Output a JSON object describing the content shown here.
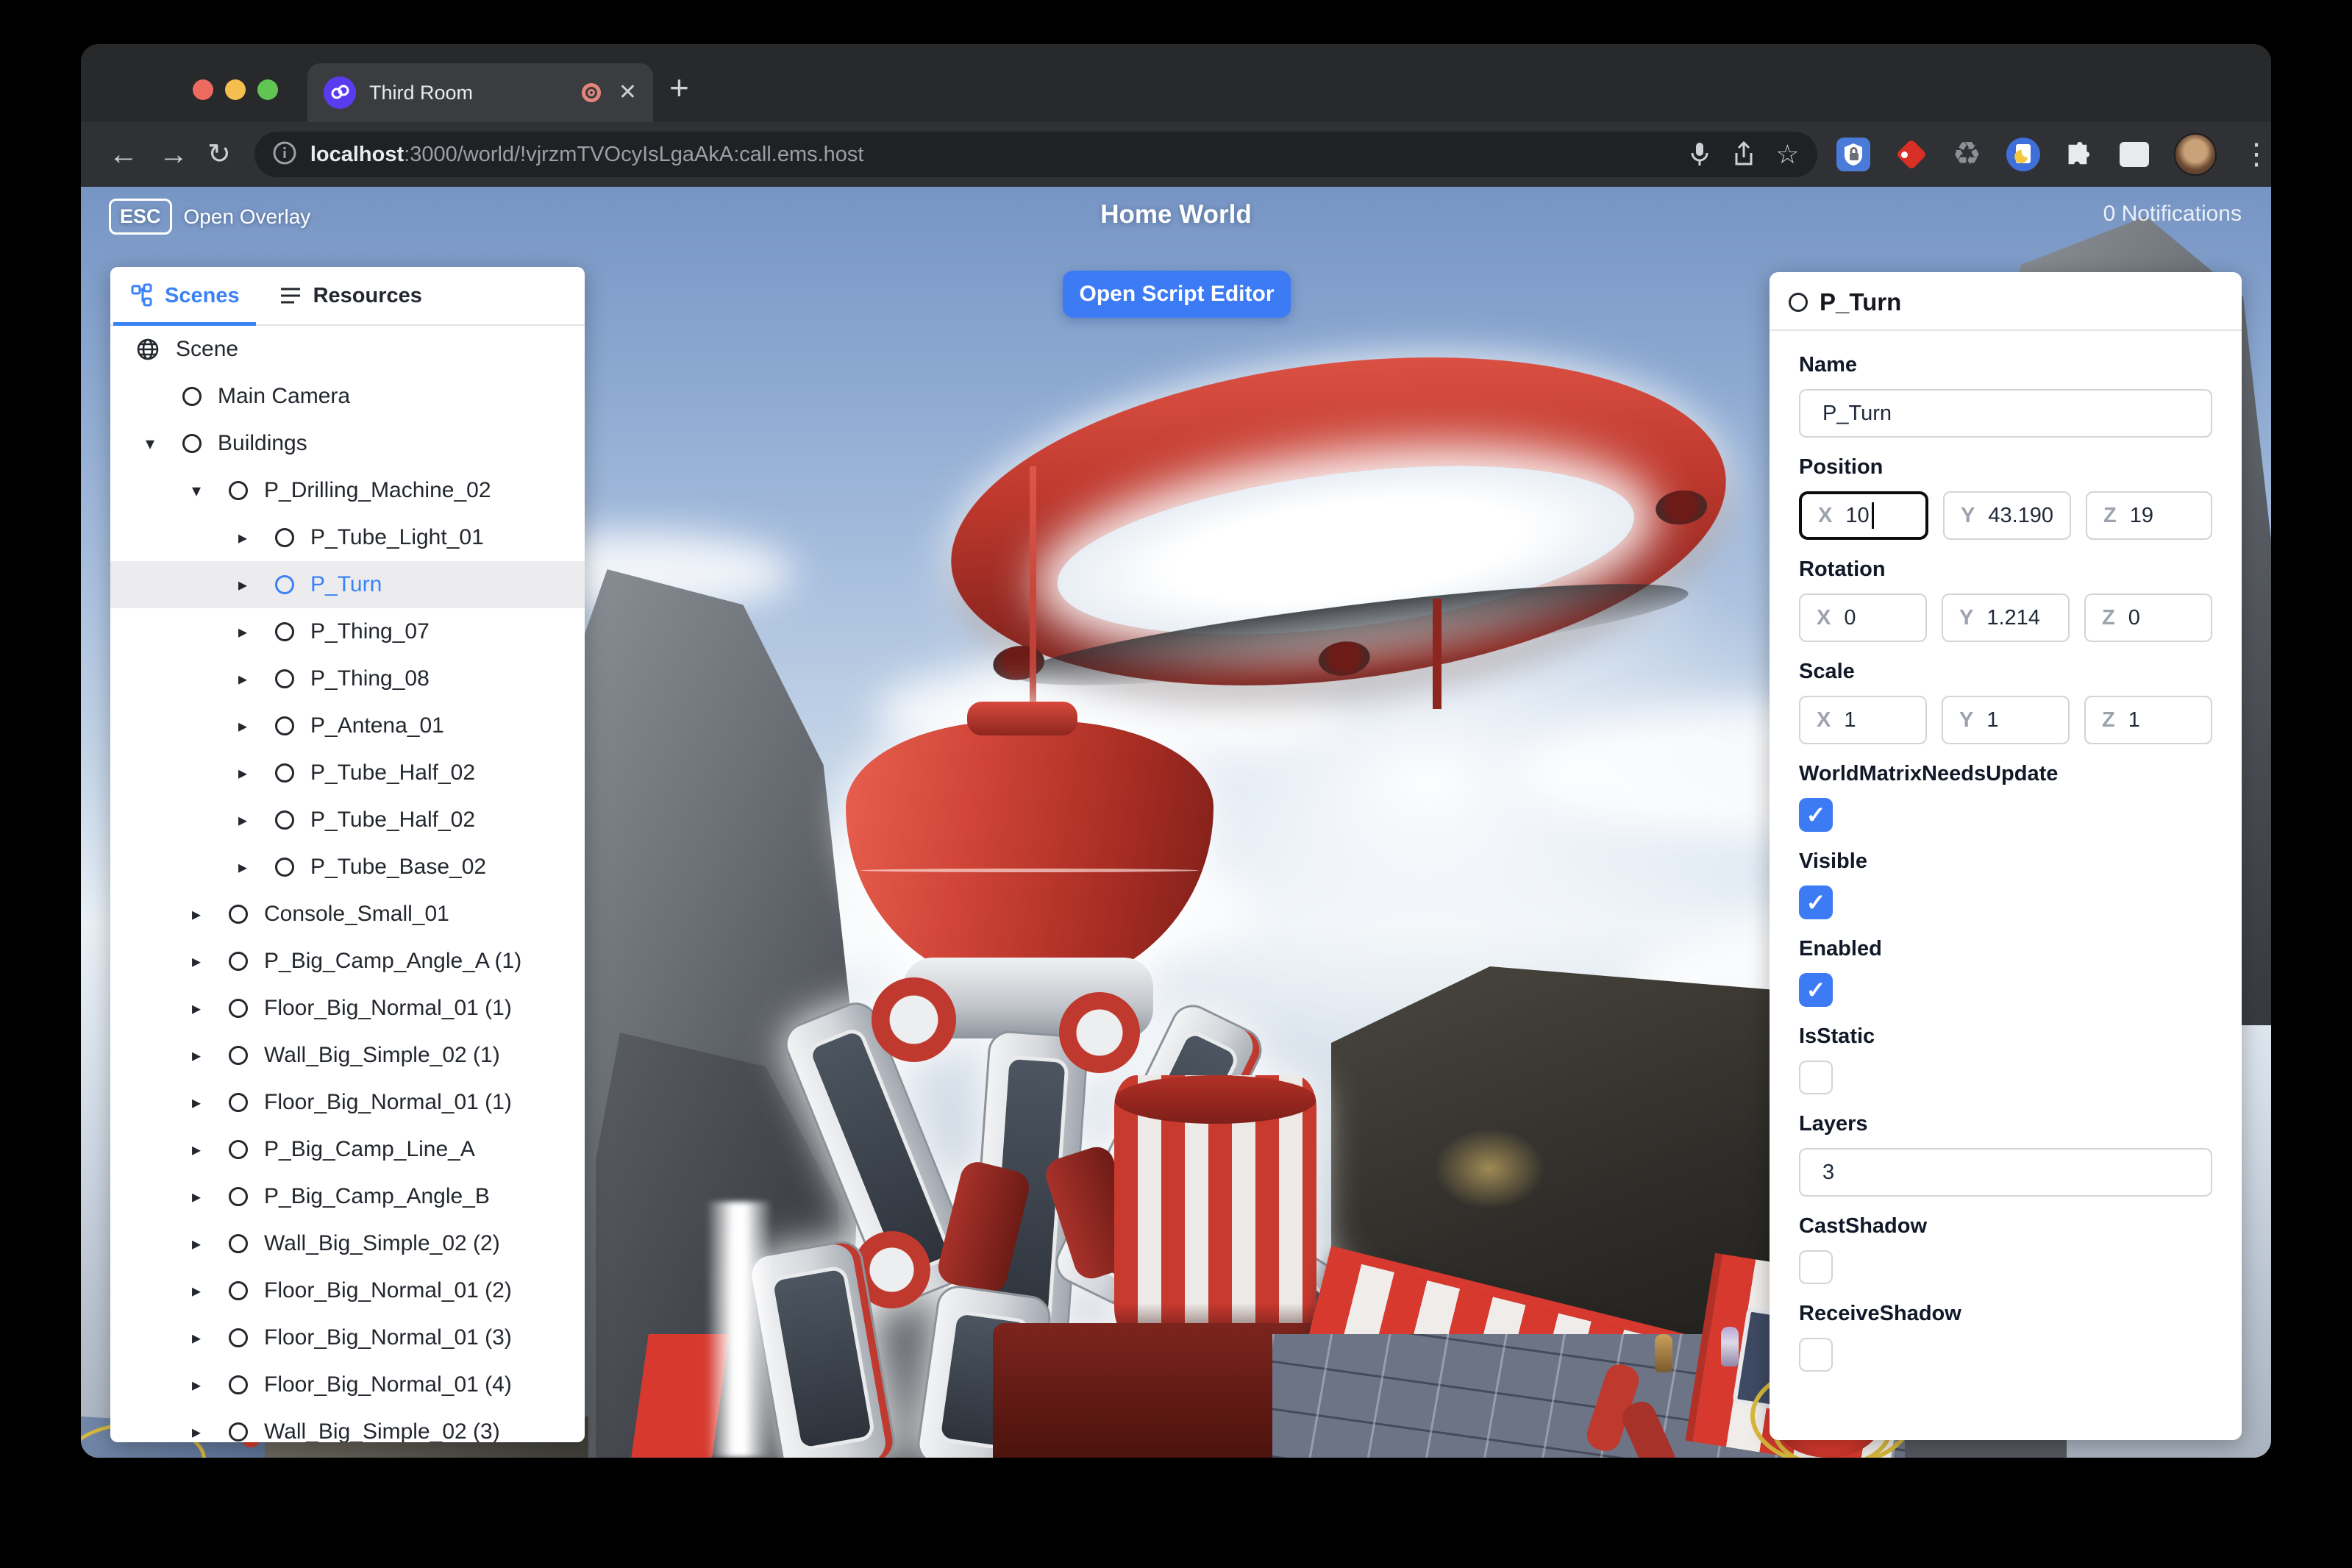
{
  "browser": {
    "tab_title": "Third Room",
    "url_host": "localhost",
    "url_rest": ":3000/world/!vjrzmTVOcyIsLgaAkA:call.ems.host",
    "glyphs": {
      "new_tab": "+",
      "close": "✕",
      "back": "←",
      "forward": "→",
      "reload": "↻",
      "star": "☆",
      "recycle": "♻",
      "kebab": "⋮",
      "check": "✓"
    }
  },
  "hud": {
    "esc_key": "ESC",
    "open_overlay_label": "Open Overlay",
    "world_title": "Home World",
    "notifications": "0 Notifications",
    "script_editor_label": "Open Script Editor"
  },
  "left_panel": {
    "tabs": [
      {
        "label": "Scenes",
        "active": true
      },
      {
        "label": "Resources",
        "active": false
      }
    ],
    "tree": [
      {
        "label": "Scene",
        "depth": 0,
        "arrow": "",
        "icon": "globe",
        "selected": false
      },
      {
        "label": "Main Camera",
        "depth": 1,
        "arrow": "",
        "icon": "node",
        "selected": false
      },
      {
        "label": "Buildings",
        "depth": 1,
        "arrow": "down",
        "icon": "node",
        "selected": false
      },
      {
        "label": "P_Drilling_Machine_02",
        "depth": 2,
        "arrow": "down",
        "icon": "node",
        "selected": false
      },
      {
        "label": "P_Tube_Light_01",
        "depth": 3,
        "arrow": "right",
        "icon": "node",
        "selected": false
      },
      {
        "label": "P_Turn",
        "depth": 3,
        "arrow": "right",
        "icon": "node",
        "selected": true
      },
      {
        "label": "P_Thing_07",
        "depth": 3,
        "arrow": "right",
        "icon": "node",
        "selected": false
      },
      {
        "label": "P_Thing_08",
        "depth": 3,
        "arrow": "right",
        "icon": "node",
        "selected": false
      },
      {
        "label": "P_Antena_01",
        "depth": 3,
        "arrow": "right",
        "icon": "node",
        "selected": false
      },
      {
        "label": "P_Tube_Half_02",
        "depth": 3,
        "arrow": "right",
        "icon": "node",
        "selected": false
      },
      {
        "label": "P_Tube_Half_02",
        "depth": 3,
        "arrow": "right",
        "icon": "node",
        "selected": false
      },
      {
        "label": "P_Tube_Base_02",
        "depth": 3,
        "arrow": "right",
        "icon": "node",
        "selected": false
      },
      {
        "label": "Console_Small_01",
        "depth": 2,
        "arrow": "right",
        "icon": "node",
        "selected": false
      },
      {
        "label": "P_Big_Camp_Angle_A (1)",
        "depth": 2,
        "arrow": "right",
        "icon": "node",
        "selected": false
      },
      {
        "label": "Floor_Big_Normal_01 (1)",
        "depth": 2,
        "arrow": "right",
        "icon": "node",
        "selected": false
      },
      {
        "label": "Wall_Big_Simple_02 (1)",
        "depth": 2,
        "arrow": "right",
        "icon": "node",
        "selected": false
      },
      {
        "label": "Floor_Big_Normal_01 (1)",
        "depth": 2,
        "arrow": "right",
        "icon": "node",
        "selected": false
      },
      {
        "label": "P_Big_Camp_Line_A",
        "depth": 2,
        "arrow": "right",
        "icon": "node",
        "selected": false
      },
      {
        "label": "P_Big_Camp_Angle_B",
        "depth": 2,
        "arrow": "right",
        "icon": "node",
        "selected": false
      },
      {
        "label": "Wall_Big_Simple_02 (2)",
        "depth": 2,
        "arrow": "right",
        "icon": "node",
        "selected": false
      },
      {
        "label": "Floor_Big_Normal_01 (2)",
        "depth": 2,
        "arrow": "right",
        "icon": "node",
        "selected": false
      },
      {
        "label": "Floor_Big_Normal_01 (3)",
        "depth": 2,
        "arrow": "right",
        "icon": "node",
        "selected": false
      },
      {
        "label": "Floor_Big_Normal_01 (4)",
        "depth": 2,
        "arrow": "right",
        "icon": "node",
        "selected": false
      },
      {
        "label": "Wall_Big_Simple_02 (3)",
        "depth": 2,
        "arrow": "right",
        "icon": "node",
        "selected": false
      }
    ]
  },
  "right_panel": {
    "header": "P_Turn",
    "axis": {
      "x": "X",
      "y": "Y",
      "z": "Z"
    },
    "fields": [
      {
        "type": "text",
        "name": "name",
        "label": "Name",
        "value": "P_Turn"
      },
      {
        "type": "vec3",
        "name": "position",
        "label": "Position",
        "x": "10",
        "y": "43.190",
        "z": "19",
        "focused": "x"
      },
      {
        "type": "vec3",
        "name": "rotation",
        "label": "Rotation",
        "x": "0",
        "y": "1.214",
        "z": "0"
      },
      {
        "type": "vec3",
        "name": "scale",
        "label": "Scale",
        "x": "1",
        "y": "1",
        "z": "1"
      },
      {
        "type": "check",
        "name": "worldmatrixneedsupdate",
        "label": "WorldMatrixNeedsUpdate",
        "checked": true
      },
      {
        "type": "check",
        "name": "visible",
        "label": "Visible",
        "checked": true
      },
      {
        "type": "check",
        "name": "enabled",
        "label": "Enabled",
        "checked": true
      },
      {
        "type": "check",
        "name": "isstatic",
        "label": "IsStatic",
        "checked": false
      },
      {
        "type": "text",
        "name": "layers",
        "label": "Layers",
        "value": "3"
      },
      {
        "type": "check",
        "name": "castshadow",
        "label": "CastShadow",
        "checked": false
      },
      {
        "type": "check",
        "name": "receiveshadow",
        "label": "ReceiveShadow",
        "checked": false
      }
    ]
  },
  "colors": {
    "accent_blue": "#3d7bf4",
    "selected_text": "#3b82f6",
    "machine_red": "#c0392e"
  }
}
